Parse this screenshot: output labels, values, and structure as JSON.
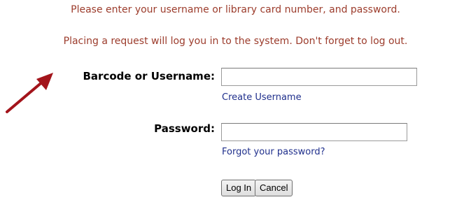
{
  "messages": {
    "line1": "Please enter your username or library card number, and password.",
    "line2": "Placing a request will log you in to the system. Don't forget to log out."
  },
  "username": {
    "label": "Barcode or Username:",
    "value": "",
    "link": "Create Username"
  },
  "password": {
    "label": "Password:",
    "value": "",
    "link": "Forgot your password?"
  },
  "buttons": {
    "login": "Log In",
    "cancel": "Cancel"
  },
  "colors": {
    "message_text": "#9c3c2c",
    "link": "#1f2f8c",
    "annotation_arrow": "#a3141b"
  },
  "annotation": {
    "icon": "arrow-up-right-icon"
  }
}
